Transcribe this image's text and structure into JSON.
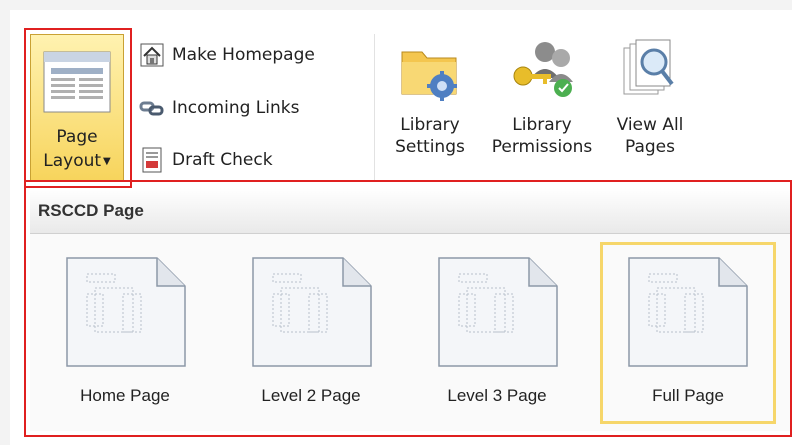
{
  "ribbon": {
    "page_layout": {
      "label_line1": "Page",
      "label_line2": "Layout",
      "icon": "page-layout-icon"
    },
    "small_buttons": [
      {
        "label": "Make Homepage",
        "icon": "home-icon"
      },
      {
        "label": "Incoming Links",
        "icon": "links-icon"
      },
      {
        "label": "Draft Check",
        "icon": "draft-check-icon"
      }
    ],
    "large_buttons": [
      {
        "line1": "Library",
        "line2": "Settings",
        "icon": "folder-gear-icon"
      },
      {
        "line1": "Library",
        "line2": "Permissions",
        "icon": "keys-users-icon"
      },
      {
        "line1": "View All",
        "line2": "Pages",
        "icon": "view-pages-icon"
      }
    ]
  },
  "gallery": {
    "title": "RSCCD Page",
    "tiles": [
      {
        "label": "Home Page",
        "selected": false
      },
      {
        "label": "Level 2 Page",
        "selected": false
      },
      {
        "label": "Level 3 Page",
        "selected": false
      },
      {
        "label": "Full Page",
        "selected": true
      }
    ]
  },
  "colors": {
    "highlight_red": "#e02020",
    "selected_yellow": "#f6d66a",
    "button_active": "#f7d45c"
  }
}
